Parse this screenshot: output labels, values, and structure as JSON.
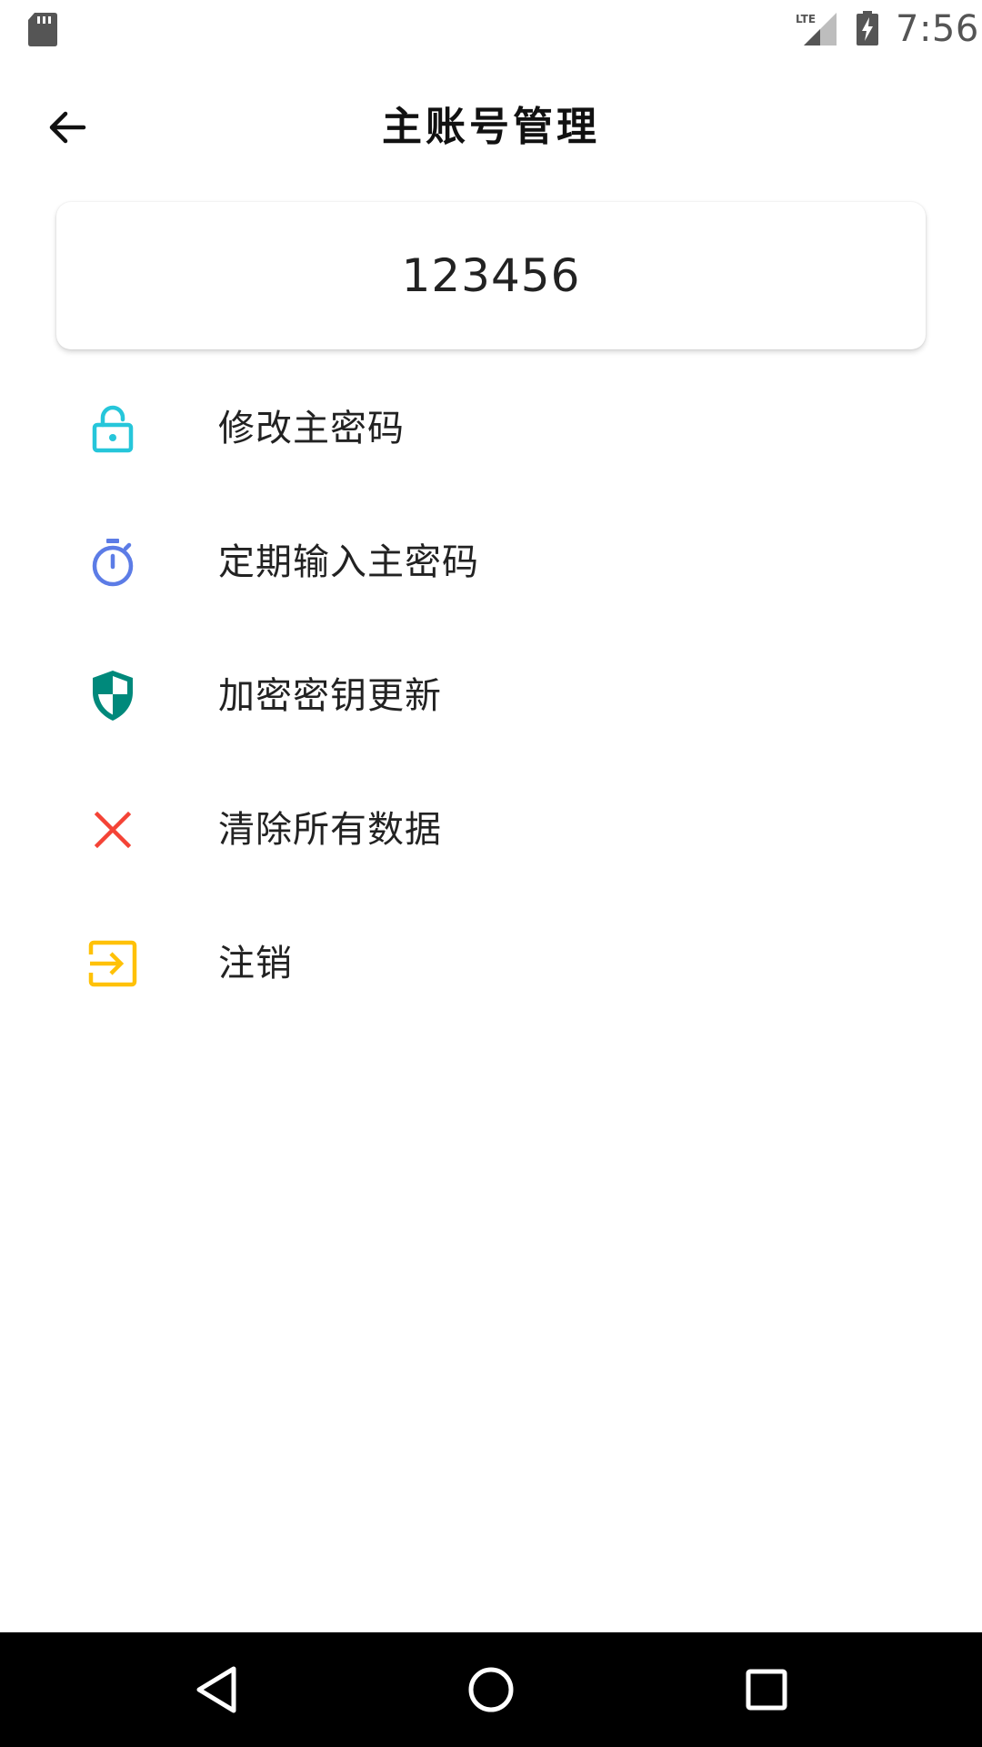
{
  "status_bar": {
    "network_label": "LTE",
    "time": "7:56",
    "icons": [
      "sd-card-icon",
      "lte-signal-icon",
      "battery-charging-icon"
    ]
  },
  "app_bar": {
    "title": "主账号管理",
    "back_icon": "arrow-left-icon"
  },
  "account": {
    "name": "123456"
  },
  "menu": {
    "items": [
      {
        "label": "修改主密码",
        "icon": "unlock-icon",
        "color": "#26C6DA"
      },
      {
        "label": "定期输入主密码",
        "icon": "timer-icon",
        "color": "#5C7CE6"
      },
      {
        "label": "加密密钥更新",
        "icon": "shield-icon",
        "color": "#00897B"
      },
      {
        "label": "清除所有数据",
        "icon": "close-icon",
        "color": "#F44336"
      },
      {
        "label": "注销",
        "icon": "exit-icon",
        "color": "#FFC107"
      }
    ]
  },
  "nav_bar": {
    "icons": [
      "back-triangle-icon",
      "home-circle-icon",
      "recents-square-icon"
    ]
  }
}
